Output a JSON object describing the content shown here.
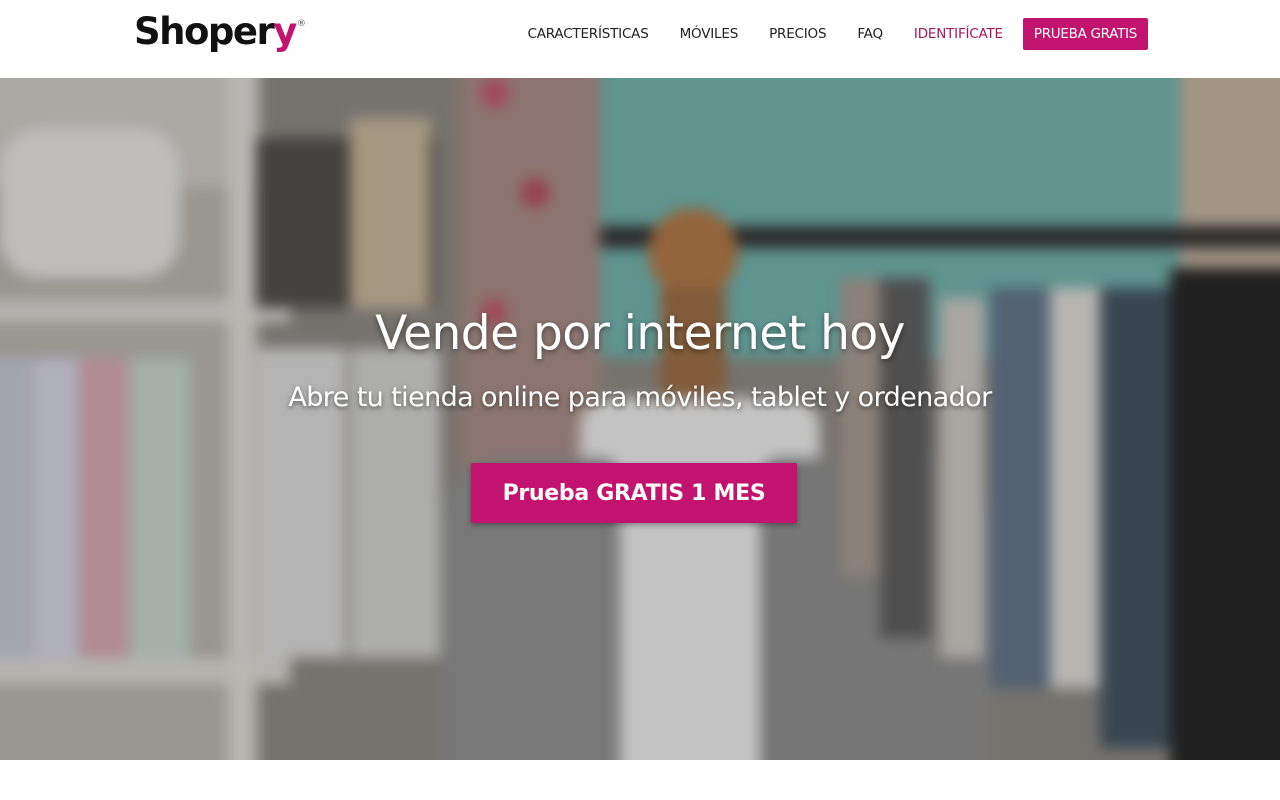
{
  "header": {
    "logo": {
      "text_main": "Shoper",
      "text_accent": "y",
      "registered_mark": "®"
    },
    "nav": [
      {
        "label": "CARACTERÍSTICAS"
      },
      {
        "label": "MÓVILES"
      },
      {
        "label": "PRECIOS"
      },
      {
        "label": "FAQ"
      },
      {
        "label": "IDENTIFÍCATE"
      }
    ],
    "cta_label": "PRUEBA GRATIS"
  },
  "hero": {
    "title": "Vende por internet hoy",
    "subtitle": "Abre tu tienda online para móviles, tablet y ordenador",
    "cta_label": "Prueba GRATIS 1 MES",
    "background_icon": "blurred-boutique-photo"
  },
  "colors": {
    "brand": "#c2146e",
    "login_link": "#a5185e",
    "header_bg": "#ffffff",
    "text_dark": "#222222"
  }
}
